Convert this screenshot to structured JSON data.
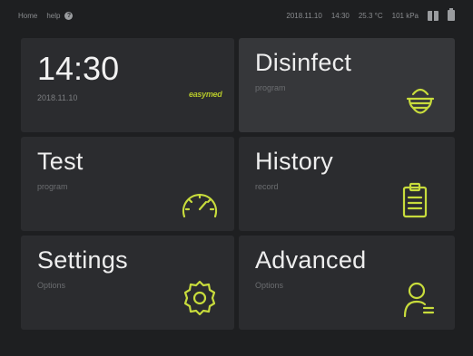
{
  "status_bar": {
    "home": "Home",
    "help": "help",
    "help_icon": "?",
    "date": "2018.11.10",
    "time": "14:30",
    "temperature": "25.3 °C",
    "pressure": "101 kPa"
  },
  "clock": {
    "time": "14:30",
    "date": "2018.11.10",
    "logo": "easymed"
  },
  "tiles": {
    "disinfect": {
      "title": "Disinfect",
      "sub": "program"
    },
    "test": {
      "title": "Test",
      "sub": "program"
    },
    "history": {
      "title": "History",
      "sub": "record"
    },
    "settings": {
      "title": "Settings",
      "sub": "Options"
    },
    "advanced": {
      "title": "Advanced",
      "sub": "Options"
    }
  },
  "colors": {
    "accent": "#c8dc3c",
    "tile_bg": "#2b2c2f",
    "tile_highlight": "#36373a",
    "background": "#1e1f21"
  }
}
